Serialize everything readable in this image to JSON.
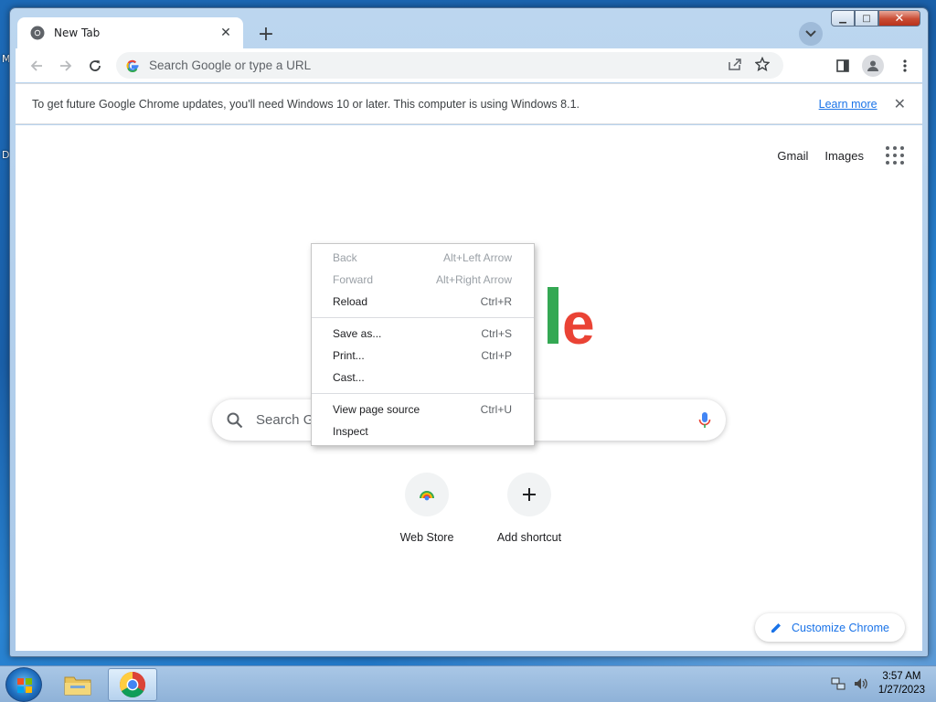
{
  "desktop": {
    "label_m": "M",
    "label_d": "D"
  },
  "window": {
    "min": "▁",
    "max": "□",
    "close": "✕"
  },
  "tab": {
    "title": "New Tab",
    "close": "✕"
  },
  "toolbar": {
    "new_tab": "+"
  },
  "omnibox": {
    "placeholder": "Search Google or type a URL"
  },
  "infobar": {
    "message": "To get future Google Chrome updates, you'll need Windows 10 or later. This computer is using Windows 8.1.",
    "link": "Learn more",
    "close": "✕"
  },
  "ntp": {
    "gmail": "Gmail",
    "images": "Images",
    "logo_tail": "le",
    "search_placeholder": "Search G",
    "tiles": [
      {
        "label": "Web Store"
      },
      {
        "label": "Add shortcut"
      }
    ],
    "customize": "Customize Chrome"
  },
  "context_menu": {
    "items": [
      {
        "label": "Back",
        "shortcut": "Alt+Left Arrow",
        "disabled": true
      },
      {
        "label": "Forward",
        "shortcut": "Alt+Right Arrow",
        "disabled": true
      },
      {
        "label": "Reload",
        "shortcut": "Ctrl+R",
        "disabled": false
      },
      {
        "label": "Save as...",
        "shortcut": "Ctrl+S",
        "disabled": false
      },
      {
        "label": "Print...",
        "shortcut": "Ctrl+P",
        "disabled": false
      },
      {
        "label": "Cast...",
        "shortcut": "",
        "disabled": false
      },
      {
        "label": "View page source",
        "shortcut": "Ctrl+U",
        "disabled": false
      },
      {
        "label": "Inspect",
        "shortcut": "",
        "disabled": false
      }
    ]
  },
  "taskbar": {
    "time": "3:57 AM",
    "date": "1/27/2023"
  },
  "colors": {
    "accent": "#1a73e8",
    "google_green": "#34a853",
    "google_red": "#ea4335"
  }
}
